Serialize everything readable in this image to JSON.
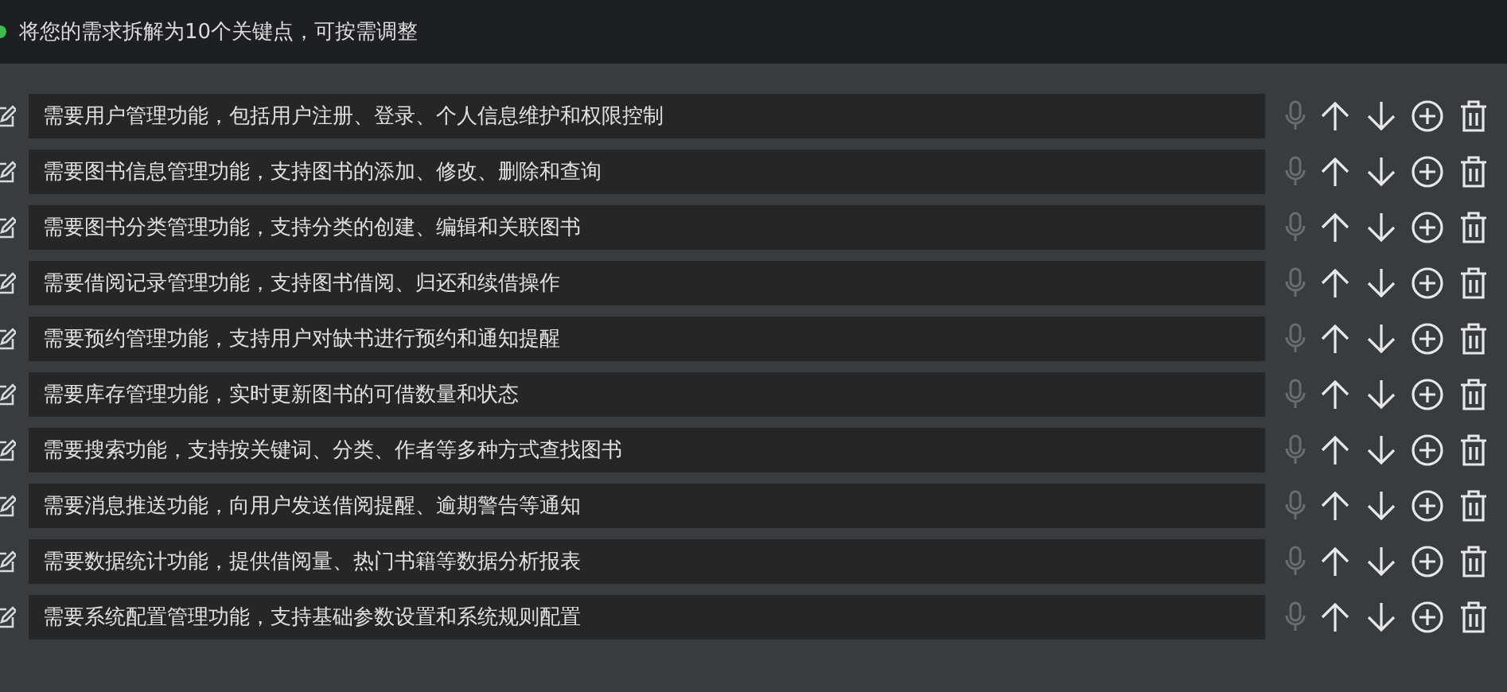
{
  "header": {
    "text": "将您的需求拆解为10个关键点，可按需调整"
  },
  "items": [
    {
      "value": "需要用户管理功能，包括用户注册、登录、个人信息维护和权限控制",
      "mic_disabled": true
    },
    {
      "value": "需要图书信息管理功能，支持图书的添加、修改、删除和查询",
      "mic_disabled": true
    },
    {
      "value": "需要图书分类管理功能，支持分类的创建、编辑和关联图书",
      "mic_disabled": true
    },
    {
      "value": "需要借阅记录管理功能，支持图书借阅、归还和续借操作",
      "mic_disabled": true
    },
    {
      "value": "需要预约管理功能，支持用户对缺书进行预约和通知提醒",
      "mic_disabled": true
    },
    {
      "value": "需要库存管理功能，实时更新图书的可借数量和状态",
      "mic_disabled": true
    },
    {
      "value": "需要搜索功能，支持按关键词、分类、作者等多种方式查找图书",
      "mic_disabled": true
    },
    {
      "value": "需要消息推送功能，向用户发送借阅提醒、逾期警告等通知",
      "mic_disabled": true
    },
    {
      "value": "需要数据统计功能，提供借阅量、热门书籍等数据分析报表",
      "mic_disabled": true
    },
    {
      "value": "需要系统配置管理功能，支持基础参数设置和系统规则配置",
      "mic_disabled": true
    }
  ]
}
